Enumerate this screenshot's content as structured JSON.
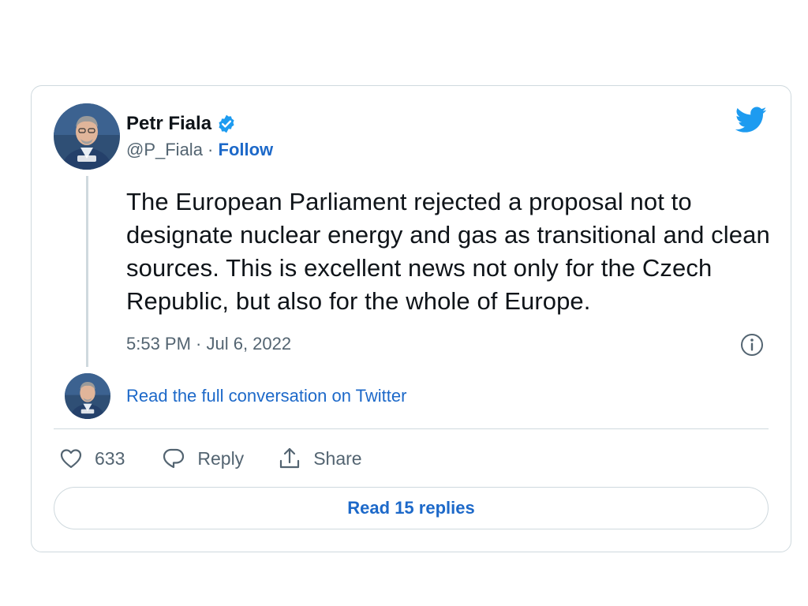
{
  "tweet": {
    "author_name": "Petr Fiala",
    "handle": "@P_Fiala",
    "separator": " · ",
    "follow_label": "Follow",
    "text": "The European Parliament rejected a proposal not to designate nuclear energy and gas as transitional and clean sources. This is excellent news not only for the Czech Republic, but also for the whole of Europe.",
    "timestamp": "5:53 PM · Jul 6, 2022",
    "read_conversation_label": "Read the full conversation on Twitter",
    "like_count": "633",
    "reply_label": "Reply",
    "share_label": "Share",
    "read_replies_label": "Read 15 replies"
  },
  "icons": {
    "verified": "verified-badge-icon",
    "brand": "twitter-bird-icon",
    "info": "info-icon",
    "like": "heart-icon",
    "reply": "speech-bubble-icon",
    "share": "share-icon"
  },
  "colors": {
    "accent": "#1d9bf0",
    "link": "#1d69c9",
    "text": "#0f1419",
    "muted": "#536471",
    "border": "#cfd9de"
  }
}
